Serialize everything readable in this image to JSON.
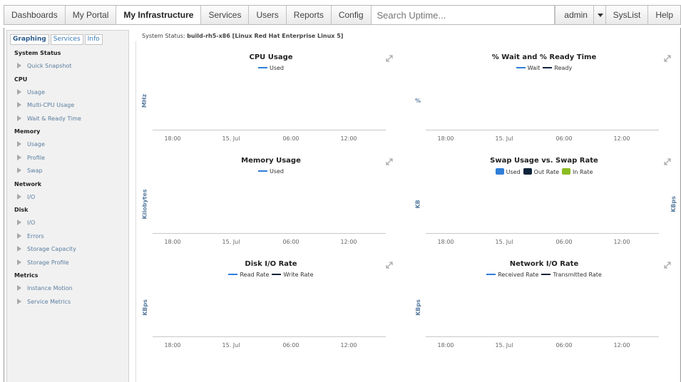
{
  "nav": {
    "tabs": [
      "Dashboards",
      "My Portal",
      "My Infrastructure",
      "Services",
      "Users",
      "Reports",
      "Config"
    ],
    "search_placeholder": "Search Uptime...",
    "user": "admin",
    "syslist": "SysList",
    "help": "Help"
  },
  "sidebar": {
    "tabs": [
      "Graphing",
      "Services",
      "Info"
    ],
    "sections": [
      {
        "title": "System Status",
        "items": [
          "Quick Snapshot"
        ]
      },
      {
        "title": "CPU",
        "items": [
          "Usage",
          "Multi-CPU Usage",
          "Wait & Ready Time"
        ]
      },
      {
        "title": "Memory",
        "items": [
          "Usage",
          "Profile",
          "Swap"
        ]
      },
      {
        "title": "Network",
        "items": [
          "I/O"
        ]
      },
      {
        "title": "Disk",
        "items": [
          "I/O",
          "Errors",
          "Storage Capacity",
          "Storage Profile"
        ]
      },
      {
        "title": "Metrics",
        "items": [
          "Instance Motion",
          "Service Metrics"
        ]
      }
    ]
  },
  "status": {
    "label": "System Status:",
    "value": "build-rh5-x86 [Linux Red Hat Enterprise Linux 5]"
  },
  "colors": {
    "link_blue": "#5a7ea0",
    "legend_blue": "#2f7ed8",
    "legend_black": "#0d233a",
    "legend_green": "#8bbc21"
  },
  "charts": [
    {
      "title": "CPU Usage",
      "ylabel": "MHz",
      "ylabel_right": "",
      "legend": [
        {
          "label": "Used",
          "color": "#2f7ed8",
          "shape": "line"
        }
      ],
      "x_ticks": [
        "18:00",
        "15. Jul",
        "06:00",
        "12:00"
      ]
    },
    {
      "title": "% Wait and % Ready Time",
      "ylabel": "%",
      "ylabel_right": "",
      "legend": [
        {
          "label": "Wait",
          "color": "#2f7ed8",
          "shape": "line"
        },
        {
          "label": "Ready",
          "color": "#0d233a",
          "shape": "line"
        }
      ],
      "x_ticks": [
        "18:00",
        "15. Jul",
        "06:00",
        "12:00"
      ]
    },
    {
      "title": "Memory Usage",
      "ylabel": "Kilobytes",
      "ylabel_right": "",
      "legend": [
        {
          "label": "Used",
          "color": "#2f7ed8",
          "shape": "line"
        }
      ],
      "x_ticks": [
        "18:00",
        "15. Jul",
        "06:00",
        "12:00"
      ]
    },
    {
      "title": "Swap Usage vs. Swap Rate",
      "ylabel": "KB",
      "ylabel_right": "KBps",
      "legend": [
        {
          "label": "Used",
          "color": "#2f7ed8",
          "shape": "box"
        },
        {
          "label": "Out Rate",
          "color": "#0d233a",
          "shape": "box"
        },
        {
          "label": "In Rate",
          "color": "#8bbc21",
          "shape": "box"
        }
      ],
      "x_ticks": [
        "18:00",
        "15. Jul",
        "06:00",
        "12:00"
      ]
    },
    {
      "title": "Disk I/O Rate",
      "ylabel": "KBps",
      "ylabel_right": "",
      "legend": [
        {
          "label": "Read Rate",
          "color": "#2f7ed8",
          "shape": "line"
        },
        {
          "label": "Write Rate",
          "color": "#0d233a",
          "shape": "line"
        }
      ],
      "x_ticks": [
        "18:00",
        "15. Jul",
        "06:00",
        "12:00"
      ]
    },
    {
      "title": "Network I/O Rate",
      "ylabel": "KBps",
      "ylabel_right": "",
      "legend": [
        {
          "label": "Received Rate",
          "color": "#2f7ed8",
          "shape": "line"
        },
        {
          "label": "Transmitted Rate",
          "color": "#0d233a",
          "shape": "line"
        }
      ],
      "x_ticks": [
        "18:00",
        "15. Jul",
        "06:00",
        "12:00"
      ]
    }
  ]
}
